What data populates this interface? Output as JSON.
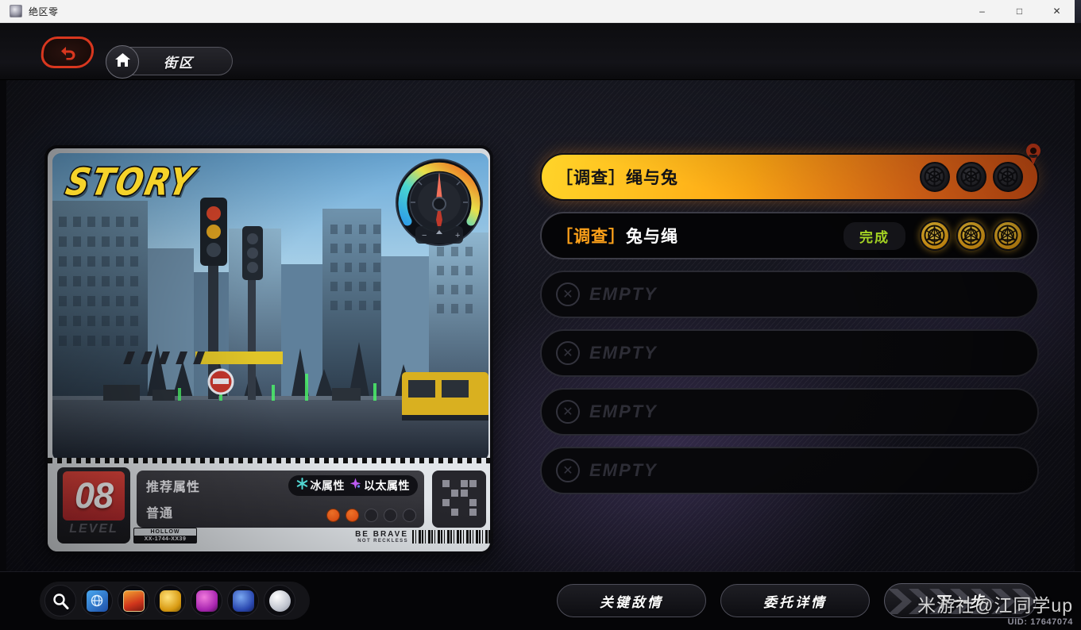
{
  "window": {
    "title": "绝区零",
    "app_icon": "game-app-icon",
    "minimize": "–",
    "maximize": "□",
    "close": "✕"
  },
  "top_nav": {
    "back_icon": "back-arrow-icon",
    "home_icon": "home-icon",
    "location_label": "街区"
  },
  "mission_card": {
    "story_logo": "STORY",
    "gauge_icon": "compass-gauge-icon",
    "level_number": "08",
    "level_word": "LEVEL",
    "recommended_attr_label": "推荐属性",
    "difficulty_label": "普通",
    "attr_tags": [
      {
        "icon": "snowflake-icon",
        "label": "冰属性",
        "color": "#56e4e0"
      },
      {
        "icon": "sparkle-icon",
        "label": "以太属性",
        "color": "#c05cf5"
      }
    ],
    "difficulty_total": 5,
    "difficulty_filled": 2,
    "difficulty_dot_color": "#ef5a16",
    "map_thumb_icon": "minimap-icon",
    "hollow_code_title": "HOLLOW",
    "hollow_code_value": "XX-1744-XX39",
    "be_brave_line1": "BE BRAVE",
    "be_brave_line2": "NOT RECKLESS",
    "barcode_icon": "barcode-icon"
  },
  "quest_list": [
    {
      "state": "active",
      "prefix": "［调查］",
      "name": "绳与兔",
      "badge": null,
      "medals": 3,
      "medal_style": "dark",
      "pin_marker": "location-pin-icon"
    },
    {
      "state": "completed",
      "prefix": "［调查］",
      "name": "兔与绳",
      "badge": "完成",
      "badge_color": "#b8ec27",
      "medals": 3,
      "medal_style": "gold",
      "pin_marker": null
    },
    {
      "state": "empty",
      "label": "EMPTY",
      "icon": "circle-x-icon"
    },
    {
      "state": "empty",
      "label": "EMPTY",
      "icon": "circle-x-icon"
    },
    {
      "state": "empty",
      "label": "EMPTY",
      "icon": "circle-x-icon"
    },
    {
      "state": "empty",
      "label": "EMPTY",
      "icon": "circle-x-icon"
    }
  ],
  "bottom_bar": {
    "quick_icons": [
      {
        "name": "search-icon",
        "color": "#ffffff"
      },
      {
        "name": "inter-knot-icon",
        "color": "#3a8fe0"
      },
      {
        "name": "video-store-icon",
        "color": "#e05a2a"
      },
      {
        "name": "gold-item-icon",
        "color": "#e0b21a"
      },
      {
        "name": "purple-item-icon",
        "color": "#d04ad0"
      },
      {
        "name": "blue-item-icon",
        "color": "#3a5ad0"
      },
      {
        "name": "silver-coin-icon",
        "color": "#d8dae0"
      }
    ],
    "actions": [
      {
        "name": "key-enemy-intel-button",
        "label": "关键敌情"
      },
      {
        "name": "commission-details-button",
        "label": "委托详情"
      }
    ],
    "next_step": {
      "label": "下一步",
      "icon": "chevrons-right-icon"
    }
  },
  "watermark": {
    "text": "米游社@江同学up",
    "uid": "UID: 17647074"
  }
}
